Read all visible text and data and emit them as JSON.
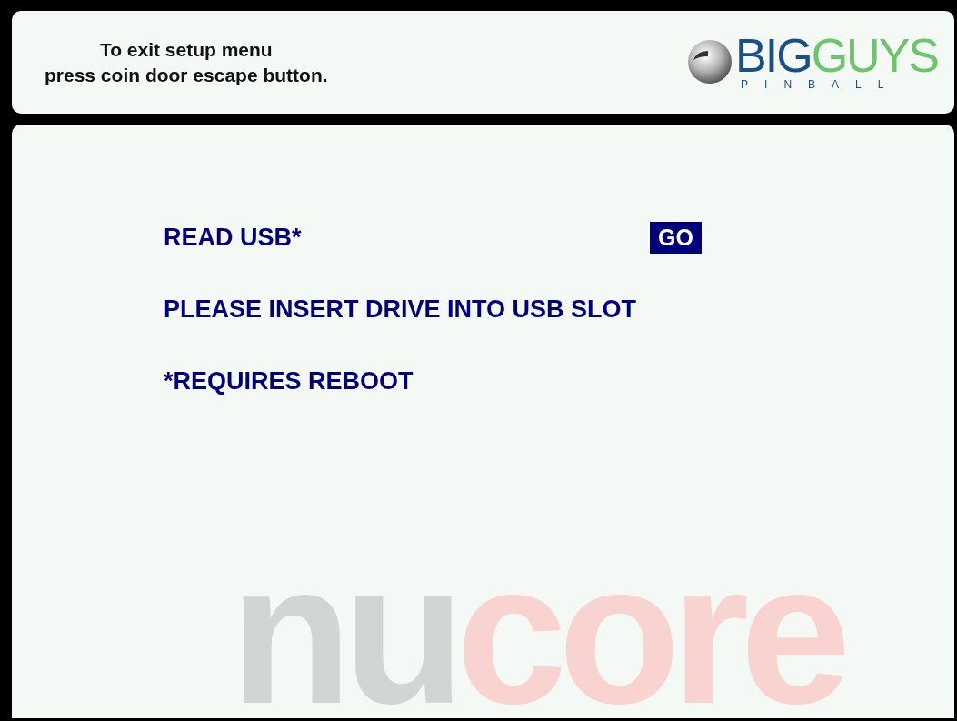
{
  "header": {
    "message_lines": [
      "To exit setup menu",
      "press coin door escape button."
    ],
    "logo": {
      "word_1": "BIG",
      "word_2": "GUYS",
      "subtitle": "PINBALL"
    }
  },
  "menu": [
    {
      "kind": "action",
      "label": "READ USB*",
      "button": "GO"
    },
    {
      "kind": "text",
      "label": "PLEASE INSERT DRIVE INTO USB SLOT"
    },
    {
      "kind": "text",
      "label": "*REQUIRES REBOOT"
    }
  ],
  "background_logo": {
    "part_1": "nu",
    "part_2": "core"
  }
}
